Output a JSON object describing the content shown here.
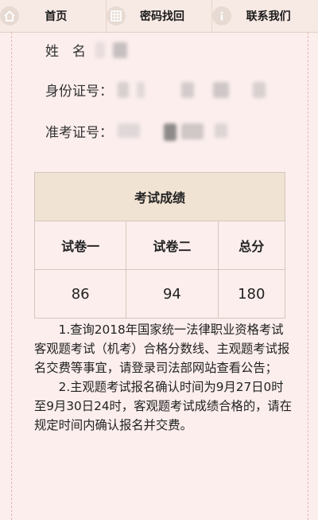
{
  "nav": {
    "items": [
      {
        "label": "首页",
        "icon": "home-icon"
      },
      {
        "label": "密码找回",
        "icon": "grid-icon"
      },
      {
        "label": "联系我们",
        "icon": "info-icon"
      }
    ]
  },
  "info": {
    "name_label": "姓　名",
    "id_label": "身份证号：",
    "exam_label": "准考证号："
  },
  "scores": {
    "title": "考试成绩",
    "headers": [
      "试卷一",
      "试卷二",
      "总分"
    ],
    "values": [
      "86",
      "94",
      "180"
    ]
  },
  "notes": [
    "1.查询2018年国家统一法律职业资格考试客观题考试（机考）合格分数线、主观题考试报名交费等事宜，请登录司法部网站查看公告；",
    "2.主观题考试报名确认时间为9月27日0时至9月30日24时，客观题考试成绩合格的，请在规定时间内确认报名并交费。"
  ]
}
